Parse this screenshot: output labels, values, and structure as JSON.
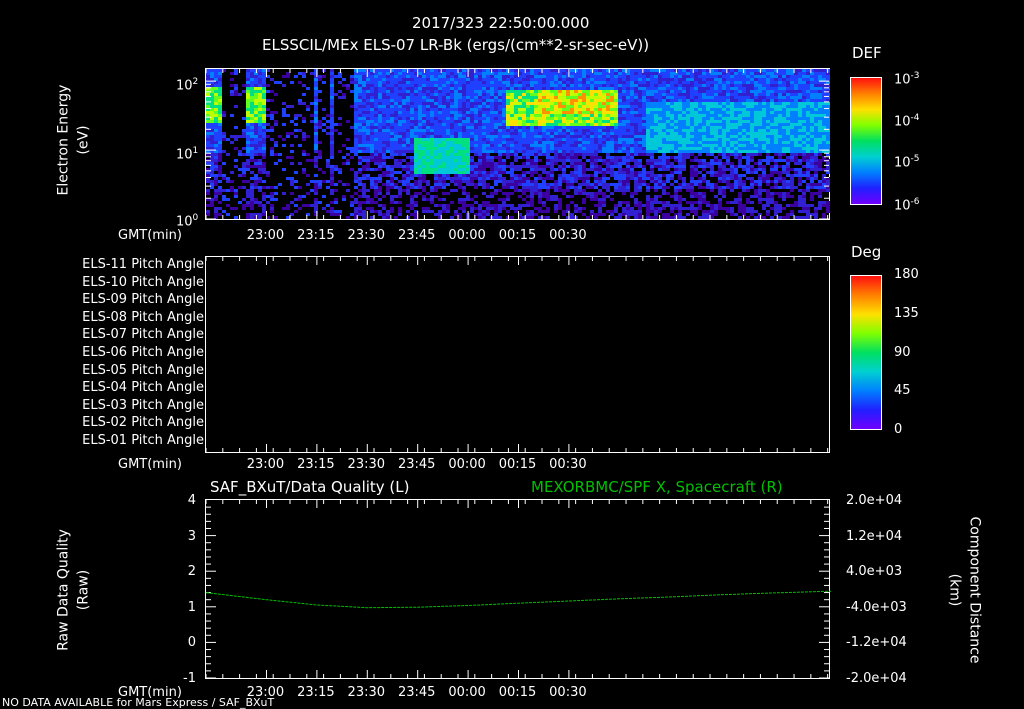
{
  "header": {
    "timestamp": "2017/323 22:50:00.000",
    "title": "ELSSCIL/MEx ELS-07 LR-Bk  (ergs/(cm**2-sr-sec-eV))"
  },
  "chart_data": [
    {
      "type": "heatmap",
      "name": "electron-spectrogram",
      "ylabel_line1": "Electron Energy",
      "ylabel_line2": "(eV)",
      "xlabel": "GMT(min)",
      "y_scale": "log",
      "ylim": [
        1,
        150
      ],
      "y_ticks": [
        {
          "base": "10",
          "exp": "0"
        },
        {
          "base": "10",
          "exp": "1"
        },
        {
          "base": "10",
          "exp": "2"
        }
      ],
      "x_ticks": [
        "23:00",
        "23:15",
        "23:30",
        "23:45",
        "00:00",
        "00:15",
        "00:30"
      ],
      "x_range_min": [
        -8,
        178
      ],
      "x_ticks_min": [
        10,
        25,
        40,
        55,
        70,
        85,
        100
      ],
      "colorbar": {
        "label": "DEF",
        "ticks": [
          {
            "base": "10",
            "exp": "-3"
          },
          {
            "base": "10",
            "exp": "-4"
          },
          {
            "base": "10",
            "exp": "-5"
          },
          {
            "base": "10",
            "exp": "-6"
          }
        ]
      }
    },
    {
      "type": "heatmap",
      "name": "pitch-angle",
      "xlabel": "GMT(min)",
      "row_labels": [
        "ELS-11 Pitch Angle",
        "ELS-10 Pitch Angle",
        "ELS-09 Pitch Angle",
        "ELS-08 Pitch Angle",
        "ELS-07 Pitch Angle",
        "ELS-06 Pitch Angle",
        "ELS-05 Pitch Angle",
        "ELS-04 Pitch Angle",
        "ELS-03 Pitch Angle",
        "ELS-02 Pitch Angle",
        "ELS-01 Pitch Angle"
      ],
      "x_ticks": [
        "23:00",
        "23:15",
        "23:30",
        "23:45",
        "00:00",
        "00:15",
        "00:30"
      ],
      "colorbar": {
        "label": "Deg",
        "ticks": [
          "180",
          "135",
          "90",
          "45",
          "0"
        ]
      }
    },
    {
      "type": "line",
      "name": "data-quality",
      "title_left": "SAF_BXuT/Data Quality (L)",
      "title_right": "MEXORBMC/SPF X, Spacecraft (R)",
      "ylabel_left_line1": "Raw Data Quality",
      "ylabel_left_line2": "(Raw)",
      "ylabel_right_line1": "Component Distance",
      "ylabel_right_line2": "(km)",
      "xlabel": "GMT(min)",
      "x_ticks": [
        "23:00",
        "23:15",
        "23:30",
        "23:45",
        "00:00",
        "00:15",
        "00:30"
      ],
      "x_ticks_min": [
        10,
        25,
        40,
        55,
        70,
        85,
        100
      ],
      "x_range_min": [
        -8,
        178
      ],
      "y_left_ticks": [
        "4",
        "3",
        "2",
        "1",
        "0",
        "-1"
      ],
      "ylim_left": [
        -1,
        4
      ],
      "y_right_ticks": [
        "2.0e+04",
        "1.2e+04",
        "4.0e+03",
        "-4.0e+03",
        "-1.2e+04",
        "-2.0e+04"
      ],
      "ylim_right": [
        -20000,
        20000
      ],
      "series": [
        {
          "name": "MEXORBMC/SPF X, Spacecraft (R)",
          "color": "#00c000",
          "axis": "right",
          "x": [
            -8,
            10,
            25,
            40,
            55,
            70,
            85,
            100,
            115,
            130,
            145,
            160,
            178
          ],
          "y": [
            -800,
            -2400,
            -3600,
            -4200,
            -4100,
            -3700,
            -3200,
            -2700,
            -2200,
            -1800,
            -1300,
            -900,
            -500
          ]
        }
      ]
    }
  ],
  "footer": {
    "note": "NO DATA AVAILABLE for Mars Express / SAF_BXuT"
  },
  "colors": {
    "background": "#000000",
    "axes": "#ffffff",
    "series": "#00c000"
  }
}
